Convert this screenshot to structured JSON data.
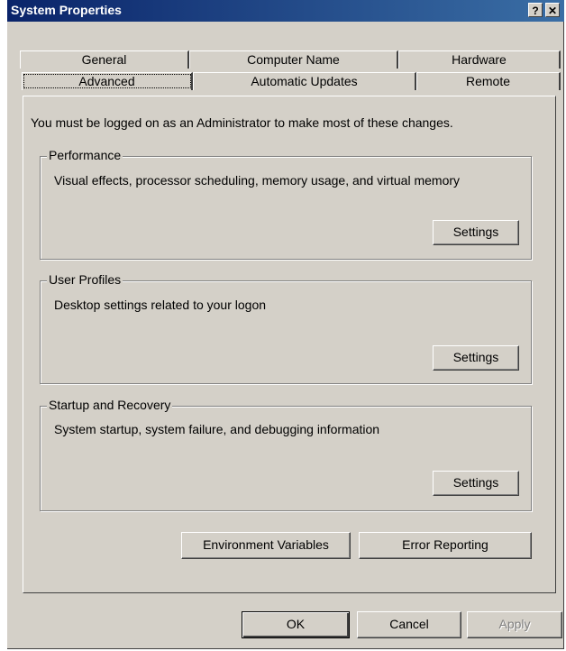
{
  "window": {
    "title": "System Properties",
    "help_label": "?",
    "close_label": "✕"
  },
  "tabs": {
    "row1": [
      {
        "label": "General"
      },
      {
        "label": "Computer Name"
      },
      {
        "label": "Hardware"
      }
    ],
    "row2": [
      {
        "label": "Advanced",
        "selected": true
      },
      {
        "label": "Automatic Updates"
      },
      {
        "label": "Remote"
      }
    ]
  },
  "notice": "You must be logged on as an Administrator to make most of these changes.",
  "groups": [
    {
      "title": "Performance",
      "description": "Visual effects, processor scheduling, memory usage, and virtual memory",
      "button_label": "Settings"
    },
    {
      "title": "User Profiles",
      "description": "Desktop settings related to your logon",
      "button_label": "Settings"
    },
    {
      "title": "Startup and Recovery",
      "description": "System startup, system failure, and debugging information",
      "button_label": "Settings"
    }
  ],
  "actions": {
    "env_vars_label": "Environment Variables",
    "error_reporting_label": "Error Reporting"
  },
  "footer": {
    "ok_label": "OK",
    "cancel_label": "Cancel",
    "apply_label": "Apply"
  },
  "colors": {
    "dialog_bg": "#d4d0c8",
    "title_gradient_start": "#0a246a",
    "title_gradient_end": "#3a6ea5"
  }
}
